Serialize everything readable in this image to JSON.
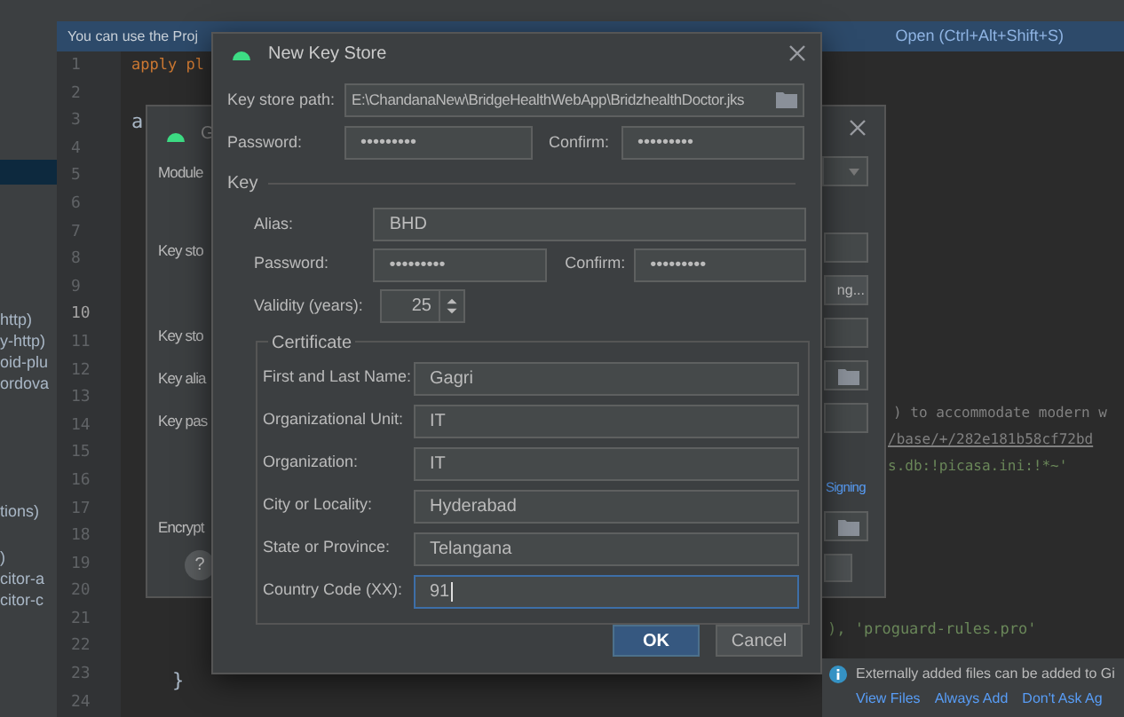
{
  "banner": {
    "text": "You can use the Proj",
    "link": "Open (Ctrl+Alt+Shift+S)"
  },
  "project_items": [
    "http)",
    "y-http)",
    "oid-plu",
    "ordova",
    "tions)",
    ")",
    "citor-a",
    "citor-c"
  ],
  "line_numbers": [
    "1",
    "2",
    "3",
    "4",
    "5",
    "6",
    "7",
    "8",
    "9",
    "10",
    "11",
    "12",
    "13",
    "14",
    "15",
    "16",
    "17",
    "18",
    "19",
    "20",
    "21",
    "22",
    "23",
    "24"
  ],
  "code_fragments": [
    "apply pl",
    "a",
    ") to accommodate modern w",
    "/base/+/282e181b58cf72bd",
    "s.db:!picasa.ini:!*~'",
    "), 'proguard-rules.pro'",
    "}"
  ],
  "back_dialog": {
    "title": "G",
    "labels": [
      "Module",
      "Key sto",
      "Key sto",
      "Key alia",
      "Key pas",
      "Encrypt"
    ],
    "button": "ng...",
    "link": "Signing",
    "help": "?"
  },
  "dialog": {
    "title": "New Key Store",
    "path": {
      "label": "Key store path:",
      "value": "E:\\ChandanaNew\\BridgeHealthWebApp\\BridzhealthDoctor.jks"
    },
    "password": {
      "label": "Password:",
      "value": "•••••••••",
      "confirm_label": "Confirm:",
      "confirm_value": "•••••••••"
    },
    "key_section": "Key",
    "alias": {
      "label": "Alias:",
      "value": "BHD"
    },
    "key_password": {
      "label": "Password:",
      "value": "•••••••••",
      "confirm_label": "Confirm:",
      "confirm_value": "•••••••••"
    },
    "validity": {
      "label": "Validity (years):",
      "value": "25"
    },
    "certificate": {
      "title": "Certificate",
      "fields": [
        {
          "label": "First and Last Name:",
          "value": "Gagri",
          "focused": false
        },
        {
          "label": "Organizational Unit:",
          "value": "IT",
          "focused": false
        },
        {
          "label": "Organization:",
          "value": "IT",
          "focused": false
        },
        {
          "label": "City or Locality:",
          "value": "Hyderabad",
          "focused": false
        },
        {
          "label": "State or Province:",
          "value": "Telangana",
          "focused": false
        },
        {
          "label": "Country Code (XX):",
          "value": "91",
          "focused": true
        }
      ]
    },
    "buttons": [
      {
        "label": "OK",
        "kind": "primary"
      },
      {
        "label": "Cancel",
        "kind": "secondary"
      }
    ]
  },
  "notification": {
    "text": "Externally added files can be added to Gi",
    "links": [
      "View Files",
      "Always Add",
      "Don't Ask Ag"
    ]
  }
}
